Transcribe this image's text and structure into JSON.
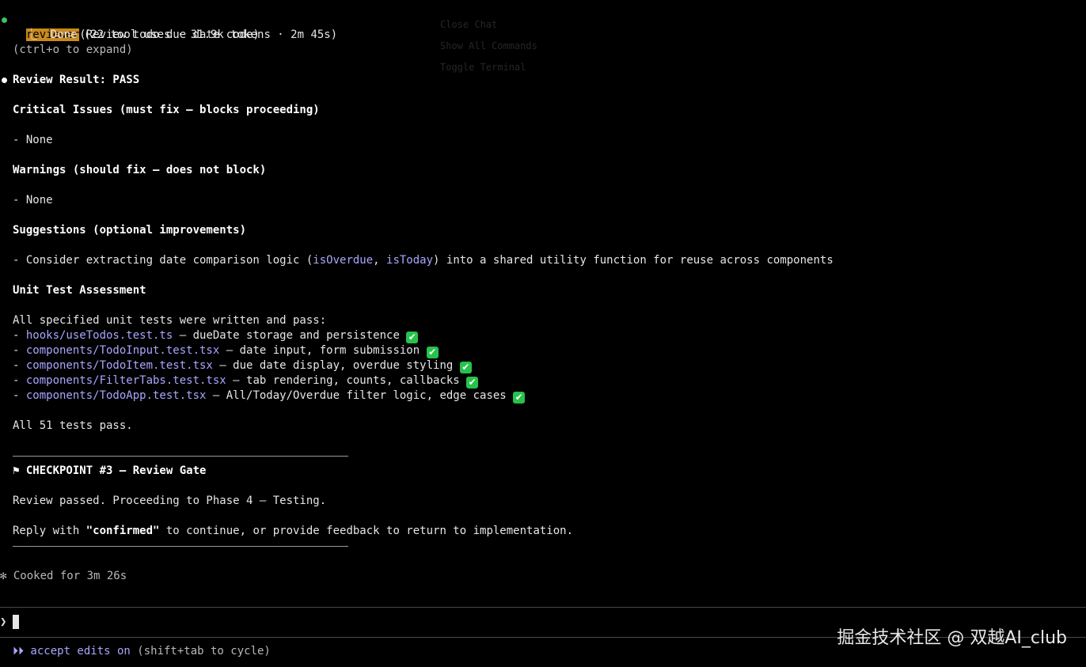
{
  "agent": {
    "name": "reviewer",
    "task": "(Review todo due date code)",
    "status": "Done (22 tool uses · 31.9k tokens · 2m 45s)",
    "expand_hint": "(ctrl+o to expand)",
    "status_color": "#3ec25c"
  },
  "review": {
    "result": "Review Result: PASS",
    "critical_heading": "Critical Issues (must fix — blocks proceeding)",
    "critical_item": "- None",
    "warnings_heading": "Warnings (should fix — does not block)",
    "warnings_item": "- None",
    "suggestions_heading": "Suggestions (optional improvements)",
    "suggestion": {
      "prefix": "- Consider extracting date comparison logic (",
      "code1": "isOverdue",
      "sep": ", ",
      "code2": "isToday",
      "suffix": ") into a shared utility function for reuse across components"
    },
    "unit_heading": "Unit Test Assessment",
    "unit_intro": "All specified unit tests were written and pass:",
    "tests": [
      {
        "file": "hooks/useTodos.test.ts",
        "desc": " — dueDate storage and persistence "
      },
      {
        "file": "components/TodoInput.test.tsx",
        "desc": " — date input, form submission "
      },
      {
        "file": "components/TodoItem.test.tsx",
        "desc": " — due date display, overdue styling "
      },
      {
        "file": "components/FilterTabs.test.tsx",
        "desc": " — tab rendering, counts, callbacks "
      },
      {
        "file": "components/TodoApp.test.tsx",
        "desc": " — All/Today/Overdue filter logic, edge cases "
      }
    ],
    "dash": "- ",
    "check_icon": "✔",
    "summary": "All 51 tests pass."
  },
  "checkpoint": {
    "title": "⚑ CHECKPOINT #3 — Review Gate",
    "line1": "Review passed. Proceeding to Phase 4 — Testing.",
    "reply_prefix": "Reply with ",
    "reply_keyword": "\"confirmed\"",
    "reply_suffix": " to continue, or provide feedback to return to implementation."
  },
  "cooked": "✻ Cooked for 3m 26s",
  "prompt": {
    "caret": "❯"
  },
  "footer": {
    "arrows": "⏵⏵",
    "mode": " accept edits on",
    "hint": " (shift+tab to cycle)"
  },
  "watermark": "掘金技术社区 @ 双越AI_club",
  "ghost_text": {
    "a": "Close Chat",
    "b": "Show All Commands",
    "c": "Toggle Terminal"
  },
  "colors": {
    "highlight": "#c9891d",
    "link_blue": "#a9a6ff",
    "check_green": "#27c24c"
  }
}
